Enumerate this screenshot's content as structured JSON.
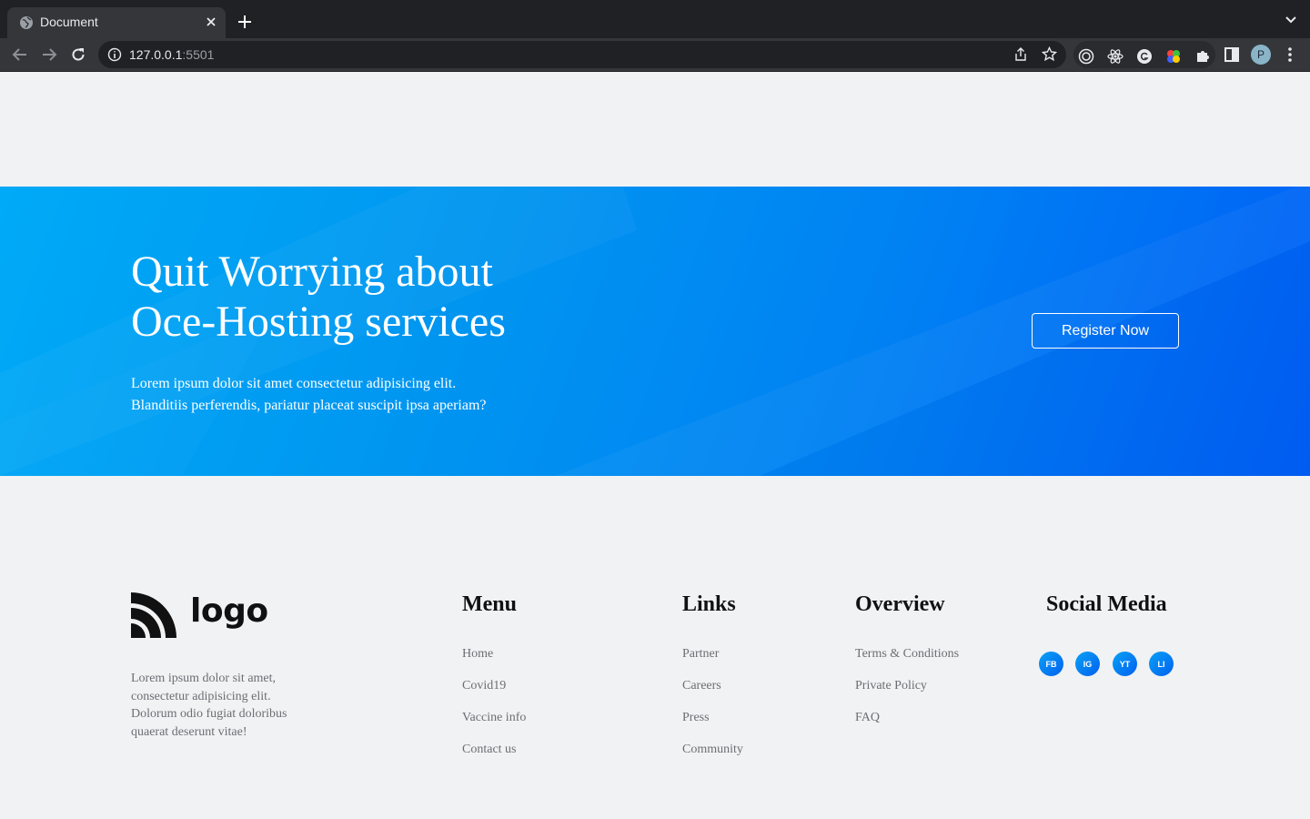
{
  "browser": {
    "tab_title": "Document",
    "url_host": "127.0.0.1",
    "url_port": ":5501",
    "avatar_initial": "P"
  },
  "hero": {
    "title_line1": "Quit Worrying about",
    "title_line2": "Oce-Hosting services",
    "text_line1": "Lorem ipsum dolor sit amet consectetur adipisicing elit.",
    "text_line2": "Blanditiis perferendis, pariatur placeat suscipit ipsa aperiam?",
    "button_label": "Register Now",
    "colors": {
      "gradient_start": "#00aaf7",
      "gradient_end": "#005ff6"
    }
  },
  "footer": {
    "logo_text": "logo",
    "about": "Lorem ipsum dolor sit amet, consectetur adipisicing elit. Dolorum odio fugiat doloribus quaerat deserunt vitae!",
    "columns": [
      {
        "heading": "Menu",
        "items": [
          "Home",
          "Covid19",
          "Vaccine info",
          "Contact us"
        ]
      },
      {
        "heading": "Links",
        "items": [
          "Partner",
          "Careers",
          "Press",
          "Community"
        ]
      },
      {
        "heading": "Overview",
        "items": [
          "Terms & Conditions",
          "Private Policy",
          "FAQ"
        ]
      }
    ],
    "social": {
      "heading": "Social Media",
      "items": [
        "FB",
        "IG",
        "YT",
        "LI"
      ]
    }
  }
}
